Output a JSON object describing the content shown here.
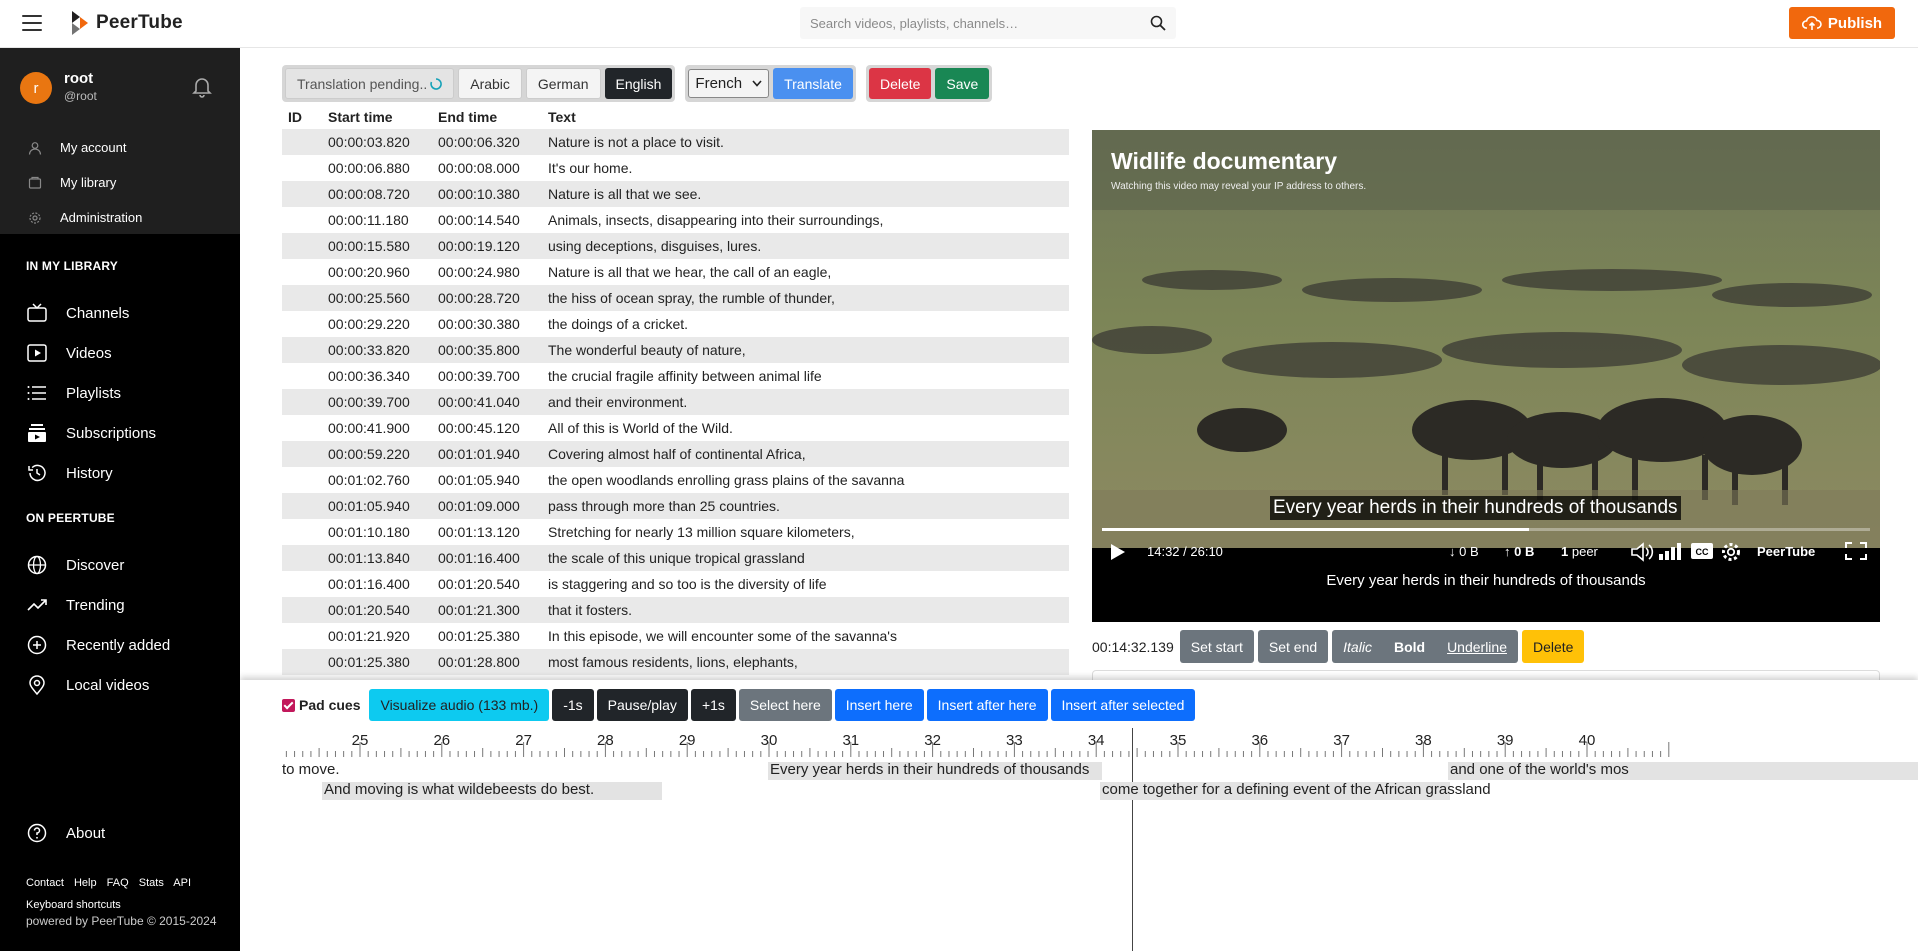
{
  "header": {
    "app_name": "PeerTube",
    "search_placeholder": "Search videos, playlists, channels…",
    "publish_label": "Publish"
  },
  "sidebar": {
    "user": {
      "initial": "r",
      "name": "root",
      "handle": "@root"
    },
    "user_links": [
      {
        "label": "My account",
        "icon": "user-icon"
      },
      {
        "label": "My library",
        "icon": "folder-icon"
      },
      {
        "label": "Administration",
        "icon": "cog-icon"
      }
    ],
    "library_title": "IN MY LIBRARY",
    "library_items": [
      {
        "label": "Channels",
        "icon": "tv-icon"
      },
      {
        "label": "Videos",
        "icon": "video-icon"
      },
      {
        "label": "Playlists",
        "icon": "list-icon"
      },
      {
        "label": "Subscriptions",
        "icon": "subscriptions-icon"
      },
      {
        "label": "History",
        "icon": "history-icon"
      }
    ],
    "peertube_title": "ON PEERTUBE",
    "peertube_items": [
      {
        "label": "Discover",
        "icon": "globe-icon"
      },
      {
        "label": "Trending",
        "icon": "trending-icon"
      },
      {
        "label": "Recently added",
        "icon": "plus-circle-icon"
      },
      {
        "label": "Local videos",
        "icon": "location-icon"
      }
    ],
    "about_label": "About",
    "footer_links": [
      "Contact",
      "Help",
      "FAQ",
      "Stats",
      "API"
    ],
    "keyboard_shortcuts": "Keyboard shortcuts",
    "powered_by": "powered by PeerTube © 2015-2024"
  },
  "toolbar": {
    "pending_label": "Translation pending..",
    "languages": [
      "Arabic",
      "German",
      "English"
    ],
    "active_language": "English",
    "target_language": "French",
    "translate_label": "Translate",
    "delete_label": "Delete",
    "save_label": "Save"
  },
  "cues": {
    "headers": [
      "ID",
      "Start time",
      "End time",
      "Text"
    ],
    "rows": [
      {
        "id": "",
        "start": "00:00:03.820",
        "end": "00:00:06.320",
        "text": "Nature is not a place to visit."
      },
      {
        "id": "",
        "start": "00:00:06.880",
        "end": "00:00:08.000",
        "text": "It's our home."
      },
      {
        "id": "",
        "start": "00:00:08.720",
        "end": "00:00:10.380",
        "text": "Nature is all that we see."
      },
      {
        "id": "",
        "start": "00:00:11.180",
        "end": "00:00:14.540",
        "text": "Animals, insects, disappearing into their surroundings,"
      },
      {
        "id": "",
        "start": "00:00:15.580",
        "end": "00:00:19.120",
        "text": "using deceptions, disguises, lures."
      },
      {
        "id": "",
        "start": "00:00:20.960",
        "end": "00:00:24.980",
        "text": "Nature is all that we hear, the call of an eagle,"
      },
      {
        "id": "",
        "start": "00:00:25.560",
        "end": "00:00:28.720",
        "text": "the hiss of ocean spray, the rumble of thunder,"
      },
      {
        "id": "",
        "start": "00:00:29.220",
        "end": "00:00:30.380",
        "text": "the doings of a cricket."
      },
      {
        "id": "",
        "start": "00:00:33.820",
        "end": "00:00:35.800",
        "text": "The wonderful beauty of nature,"
      },
      {
        "id": "",
        "start": "00:00:36.340",
        "end": "00:00:39.700",
        "text": "the crucial fragile affinity between animal life"
      },
      {
        "id": "",
        "start": "00:00:39.700",
        "end": "00:00:41.040",
        "text": "and their environment."
      },
      {
        "id": "",
        "start": "00:00:41.900",
        "end": "00:00:45.120",
        "text": "All of this is World of the Wild."
      },
      {
        "id": "",
        "start": "00:00:59.220",
        "end": "00:01:01.940",
        "text": "Covering almost half of continental Africa,"
      },
      {
        "id": "",
        "start": "00:01:02.760",
        "end": "00:01:05.940",
        "text": "the open woodlands enrolling grass plains of the savanna"
      },
      {
        "id": "",
        "start": "00:01:05.940",
        "end": "00:01:09.000",
        "text": "pass through more than 25 countries."
      },
      {
        "id": "",
        "start": "00:01:10.180",
        "end": "00:01:13.120",
        "text": "Stretching for nearly 13 million square kilometers,"
      },
      {
        "id": "",
        "start": "00:01:13.840",
        "end": "00:01:16.400",
        "text": "the scale of this unique tropical grassland"
      },
      {
        "id": "",
        "start": "00:01:16.400",
        "end": "00:01:20.540",
        "text": "is staggering and so too is the diversity of life"
      },
      {
        "id": "",
        "start": "00:01:20.540",
        "end": "00:01:21.300",
        "text": "that it fosters."
      },
      {
        "id": "",
        "start": "00:01:21.920",
        "end": "00:01:25.380",
        "text": "In this episode, we will encounter some of the savanna's"
      },
      {
        "id": "",
        "start": "00:01:25.380",
        "end": "00:01:28.800",
        "text": "most famous residents, lions, elephants,"
      }
    ]
  },
  "player": {
    "title": "Widlife documentary",
    "ip_warning": "Watching this video may reveal your IP address to others.",
    "caption": "Every year herds in their hundreds of thousands",
    "time_display": "14:32 / 26:10",
    "progress_fraction": 0.556,
    "download": "0 B",
    "upload": "0 B",
    "peers_count": "1",
    "peers_label": "peer",
    "brand": "PeerTube"
  },
  "cue_tools": {
    "current_time": "00:14:32.139",
    "set_start": "Set start",
    "set_end": "Set end",
    "italic": "Italic",
    "bold": "Bold",
    "underline": "Underline",
    "delete": "Delete"
  },
  "bottom_toolbar": {
    "pad_cues": "Pad cues",
    "visualize_audio": "Visualize audio (133 mb.)",
    "minus_1s": "-1s",
    "pause_play": "Pause/play",
    "plus_1s": "+1s",
    "select_here": "Select here",
    "insert_here": "Insert here",
    "insert_after_here": "Insert after here",
    "insert_after_selected": "Insert after selected"
  },
  "timeline": {
    "seconds": [
      25,
      26,
      27,
      28,
      29,
      30,
      31,
      32,
      33,
      34,
      35,
      36,
      37,
      38,
      39,
      40
    ],
    "cues": [
      {
        "text": "to move.",
        "lane": 0
      },
      {
        "text": "And moving is what wildebeests do best.",
        "lane": 1
      },
      {
        "text": "Every year herds in their hundreds of thousands",
        "lane": 0
      },
      {
        "text": "come together for a defining event of the African grassland",
        "lane": 1
      },
      {
        "text": "and one of the world's mos",
        "lane": 0
      }
    ]
  },
  "colors": {
    "brand_orange": "#f1680d",
    "sidebar_bg": "#000000",
    "translate_blue": "#4a90f0",
    "delete_red": "#dc3545",
    "save_green": "#198754",
    "insert_blue": "#0d6efd",
    "visualize_cyan": "#0dcaf0",
    "cue_delete_yellow": "#ffc107"
  }
}
